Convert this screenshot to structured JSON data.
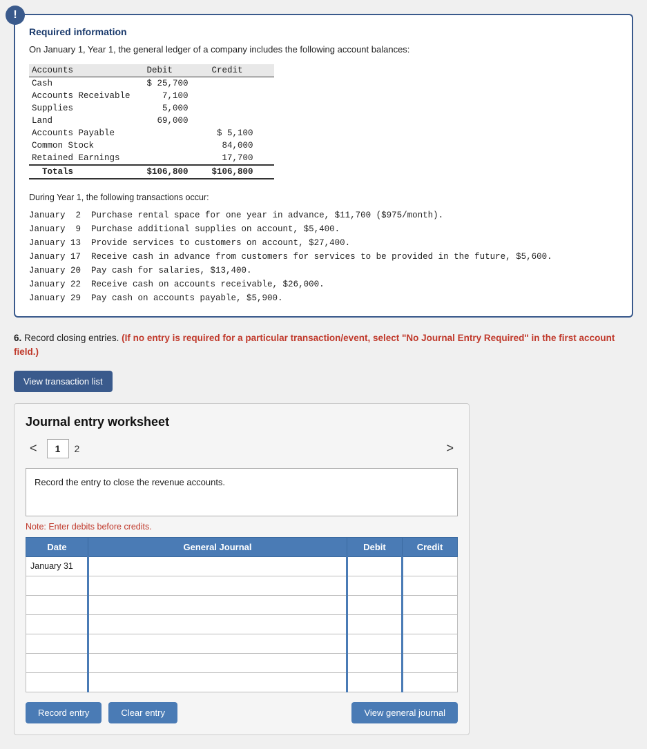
{
  "page": {
    "info_box": {
      "title": "Required information",
      "intro": "On January 1, Year 1, the general ledger of a company includes the following account balances:",
      "table": {
        "headers": [
          "Accounts",
          "Debit",
          "Credit"
        ],
        "rows": [
          [
            "Cash",
            "$ 25,700",
            ""
          ],
          [
            "Accounts Receivable",
            "7,100",
            ""
          ],
          [
            "Supplies",
            "5,000",
            ""
          ],
          [
            "Land",
            "69,000",
            ""
          ],
          [
            "Accounts Payable",
            "",
            "$ 5,100"
          ],
          [
            "Common Stock",
            "",
            "84,000"
          ],
          [
            "Retained Earnings",
            "",
            "17,700"
          ]
        ],
        "totals": [
          "Totals",
          "$106,800",
          "$106,800"
        ]
      },
      "transactions_title": "During Year 1, the following transactions occur:",
      "transactions": [
        "January  2  Purchase rental space for one year in advance, $11,700 ($975/month).",
        "January  9  Purchase additional supplies on account, $5,400.",
        "January 13  Provide services to customers on account, $27,400.",
        "January 17  Receive cash in advance from customers for services to be provided in the future, $5,600.",
        "January 20  Pay cash for salaries, $13,400.",
        "January 22  Receive cash on accounts receivable, $26,000.",
        "January 29  Pay cash on accounts payable, $5,900."
      ]
    },
    "question": {
      "number": "6.",
      "text": " Record closing entries. ",
      "highlight": "(If no entry is required for a particular transaction/event, select \"No Journal Entry Required\" in the first account field.)"
    },
    "view_transaction_btn": "View transaction list",
    "worksheet": {
      "title": "Journal entry worksheet",
      "current_page": "1",
      "total_pages": "2",
      "nav_prev": "<",
      "nav_next": ">",
      "instruction": "Record the entry to close the revenue accounts.",
      "note": "Note: Enter debits before credits.",
      "table": {
        "headers": [
          "Date",
          "General Journal",
          "Debit",
          "Credit"
        ],
        "rows": [
          {
            "date": "January 31",
            "journal": "",
            "debit": "",
            "credit": ""
          },
          {
            "date": "",
            "journal": "",
            "debit": "",
            "credit": ""
          },
          {
            "date": "",
            "journal": "",
            "debit": "",
            "credit": ""
          },
          {
            "date": "",
            "journal": "",
            "debit": "",
            "credit": ""
          },
          {
            "date": "",
            "journal": "",
            "debit": "",
            "credit": ""
          },
          {
            "date": "",
            "journal": "",
            "debit": "",
            "credit": ""
          },
          {
            "date": "",
            "journal": "",
            "debit": "",
            "credit": ""
          }
        ]
      },
      "buttons": {
        "record": "Record entry",
        "clear": "Clear entry",
        "view_journal": "View general journal"
      }
    }
  }
}
